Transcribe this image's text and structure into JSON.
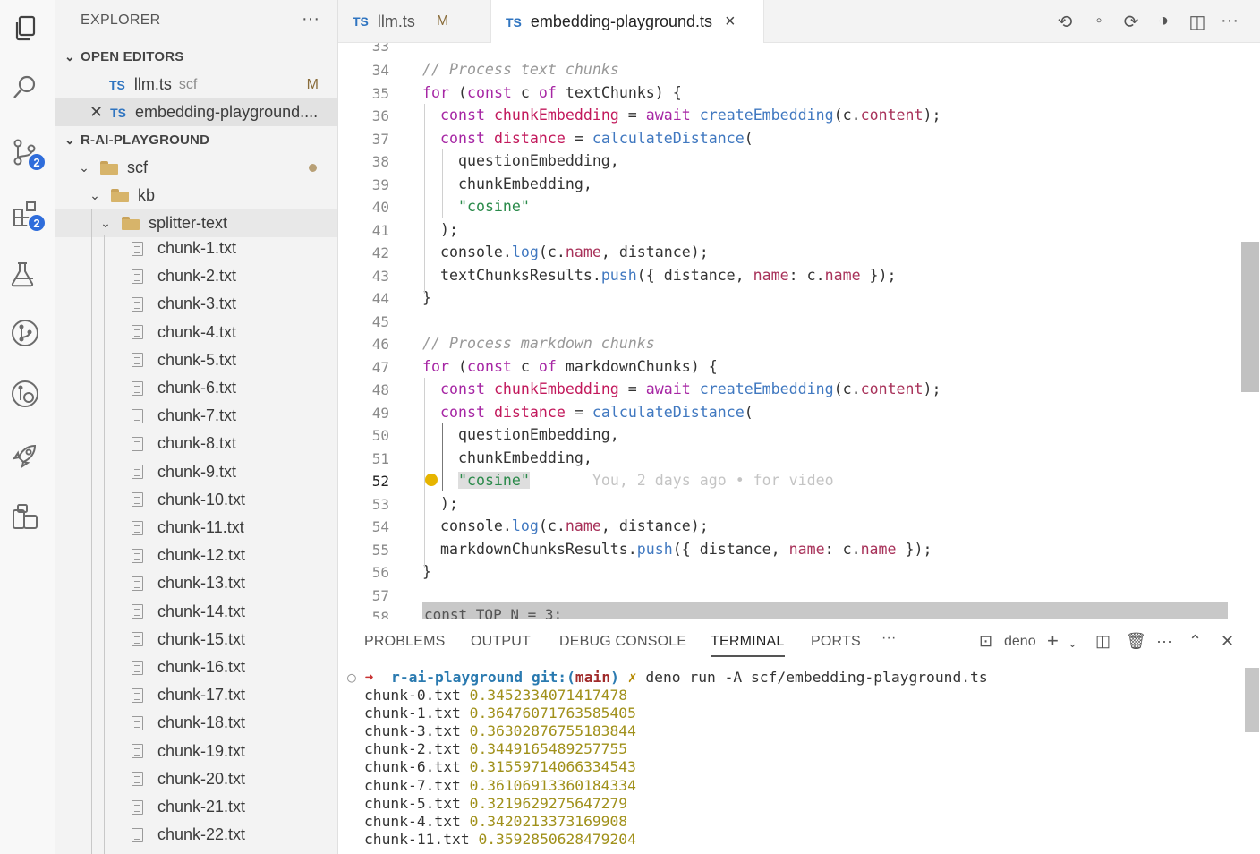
{
  "activity": {
    "source_control_badge": "2",
    "extensions_badge": "2"
  },
  "sidebar": {
    "title": "EXPLORER",
    "open_editors_header": "OPEN EDITORS",
    "open_editors": [
      {
        "type": "TS",
        "name": "llm.ts",
        "folder": "scf",
        "status": "M"
      },
      {
        "type": "TS",
        "name": "embedding-playground...."
      }
    ],
    "project_header": "R-AI-PLAYGROUND",
    "folders": [
      "scf",
      "kb",
      "splitter-text"
    ],
    "files": [
      "chunk-1.txt",
      "chunk-2.txt",
      "chunk-3.txt",
      "chunk-4.txt",
      "chunk-5.txt",
      "chunk-6.txt",
      "chunk-7.txt",
      "chunk-8.txt",
      "chunk-9.txt",
      "chunk-10.txt",
      "chunk-11.txt",
      "chunk-12.txt",
      "chunk-13.txt",
      "chunk-14.txt",
      "chunk-15.txt",
      "chunk-16.txt",
      "chunk-17.txt",
      "chunk-18.txt",
      "chunk-19.txt",
      "chunk-20.txt",
      "chunk-21.txt",
      "chunk-22.txt"
    ]
  },
  "tabs": [
    {
      "type": "TS",
      "name": "llm.ts",
      "status": "M"
    },
    {
      "type": "TS",
      "name": "embedding-playground.ts",
      "close": "×"
    }
  ],
  "editor": {
    "partial_top_line": "33",
    "lines": [
      {
        "n": "34",
        "segs": [
          [
            "cmt",
            "// Process text chunks"
          ]
        ]
      },
      {
        "n": "35",
        "segs": [
          [
            "kw",
            "for"
          ],
          [
            "",
            " ("
          ],
          [
            "kw",
            "const"
          ],
          [
            "",
            " c "
          ],
          [
            "kw",
            "of"
          ],
          [
            "",
            " textChunks) {"
          ]
        ]
      },
      {
        "n": "36",
        "segs": [
          [
            "",
            "  "
          ],
          [
            "kw",
            "const"
          ],
          [
            "",
            " "
          ],
          [
            "var",
            "chunkEmbedding"
          ],
          [
            "",
            " = "
          ],
          [
            "kw",
            "await"
          ],
          [
            "",
            " "
          ],
          [
            "fn",
            "createEmbedding"
          ],
          [
            "",
            "(c."
          ],
          [
            "prop",
            "content"
          ],
          [
            "",
            ");"
          ]
        ]
      },
      {
        "n": "37",
        "segs": [
          [
            "",
            "  "
          ],
          [
            "kw",
            "const"
          ],
          [
            "",
            " "
          ],
          [
            "var",
            "distance"
          ],
          [
            "",
            " = "
          ],
          [
            "fn",
            "calculateDistance"
          ],
          [
            "",
            "("
          ]
        ]
      },
      {
        "n": "38",
        "segs": [
          [
            "",
            "    questionEmbedding,"
          ]
        ]
      },
      {
        "n": "39",
        "segs": [
          [
            "",
            "    chunkEmbedding,"
          ]
        ]
      },
      {
        "n": "40",
        "segs": [
          [
            "",
            "    "
          ],
          [
            "str",
            "\"cosine\""
          ]
        ]
      },
      {
        "n": "41",
        "segs": [
          [
            "",
            "  );"
          ]
        ]
      },
      {
        "n": "42",
        "segs": [
          [
            "",
            "  console."
          ],
          [
            "fn",
            "log"
          ],
          [
            "",
            "(c."
          ],
          [
            "prop",
            "name"
          ],
          [
            "",
            ", distance);"
          ]
        ]
      },
      {
        "n": "43",
        "segs": [
          [
            "",
            "  textChunksResults."
          ],
          [
            "fn",
            "push"
          ],
          [
            "",
            "({ distance, "
          ],
          [
            "prop",
            "name"
          ],
          [
            "",
            ": c."
          ],
          [
            "prop",
            "name"
          ],
          [
            "",
            " });"
          ]
        ]
      },
      {
        "n": "44",
        "segs": [
          [
            "",
            "}"
          ]
        ]
      },
      {
        "n": "45",
        "segs": []
      },
      {
        "n": "46",
        "segs": [
          [
            "cmt",
            "// Process markdown chunks"
          ]
        ]
      },
      {
        "n": "47",
        "segs": [
          [
            "kw",
            "for"
          ],
          [
            "",
            " ("
          ],
          [
            "kw",
            "const"
          ],
          [
            "",
            " c "
          ],
          [
            "kw",
            "of"
          ],
          [
            "",
            " markdownChunks) {"
          ]
        ]
      },
      {
        "n": "48",
        "segs": [
          [
            "",
            "  "
          ],
          [
            "kw",
            "const"
          ],
          [
            "",
            " "
          ],
          [
            "var",
            "chunkEmbedding"
          ],
          [
            "",
            " = "
          ],
          [
            "kw",
            "await"
          ],
          [
            "",
            " "
          ],
          [
            "fn",
            "createEmbedding"
          ],
          [
            "",
            "(c."
          ],
          [
            "prop",
            "content"
          ],
          [
            "",
            ");"
          ]
        ]
      },
      {
        "n": "49",
        "segs": [
          [
            "",
            "  "
          ],
          [
            "kw",
            "const"
          ],
          [
            "",
            " "
          ],
          [
            "var",
            "distance"
          ],
          [
            "",
            " = "
          ],
          [
            "fn",
            "calculateDistance"
          ],
          [
            "",
            "("
          ]
        ]
      },
      {
        "n": "50",
        "segs": [
          [
            "",
            "    questionEmbedding,"
          ]
        ]
      },
      {
        "n": "51",
        "segs": [
          [
            "",
            "    chunkEmbedding,"
          ]
        ]
      },
      {
        "n": "52",
        "segs": [
          [
            "",
            "    "
          ],
          [
            "str hl",
            "\"cosine\""
          ],
          [
            "",
            "       "
          ],
          [
            "blame",
            "You, 2 days ago • for video"
          ]
        ]
      },
      {
        "n": "53",
        "segs": [
          [
            "",
            "  );"
          ]
        ]
      },
      {
        "n": "54",
        "segs": [
          [
            "",
            "  console."
          ],
          [
            "fn",
            "log"
          ],
          [
            "",
            "(c."
          ],
          [
            "prop",
            "name"
          ],
          [
            "",
            ", distance);"
          ]
        ]
      },
      {
        "n": "55",
        "segs": [
          [
            "",
            "  markdownChunksResults."
          ],
          [
            "fn",
            "push"
          ],
          [
            "",
            "({ distance, "
          ],
          [
            "prop",
            "name"
          ],
          [
            "",
            ": c."
          ],
          [
            "prop",
            "name"
          ],
          [
            "",
            " });"
          ]
        ]
      },
      {
        "n": "56",
        "segs": [
          [
            "",
            "}"
          ]
        ]
      },
      {
        "n": "57",
        "segs": []
      }
    ],
    "current_line": "52",
    "sticky_partial": "const TOP_N = 3;",
    "partial_bottom_line": "58"
  },
  "panel": {
    "tabs": [
      "PROBLEMS",
      "OUTPUT",
      "DEBUG CONSOLE",
      "TERMINAL",
      "PORTS"
    ],
    "active_tab": "TERMINAL",
    "more": "···",
    "shell_name": "deno",
    "terminal": {
      "prompt_dir": "r-ai-playground",
      "git_label": "git:(",
      "branch": "main",
      "git_close": ")",
      "dirty_mark": "✗",
      "command": "deno run -A scf/embedding-playground.ts",
      "output": [
        {
          "file": "chunk-0.txt",
          "value": "0.3452334071417478"
        },
        {
          "file": "chunk-1.txt",
          "value": "0.36476071763585405"
        },
        {
          "file": "chunk-3.txt",
          "value": "0.36302876755183844"
        },
        {
          "file": "chunk-2.txt",
          "value": "0.3449165489257755"
        },
        {
          "file": "chunk-6.txt",
          "value": "0.31559714066334543"
        },
        {
          "file": "chunk-7.txt",
          "value": "0.36106913360184334"
        },
        {
          "file": "chunk-5.txt",
          "value": "0.3219629275647279"
        },
        {
          "file": "chunk-4.txt",
          "value": "0.3420213373169908"
        },
        {
          "file": "chunk-11.txt",
          "value": "0.3592850628479204"
        }
      ]
    }
  }
}
